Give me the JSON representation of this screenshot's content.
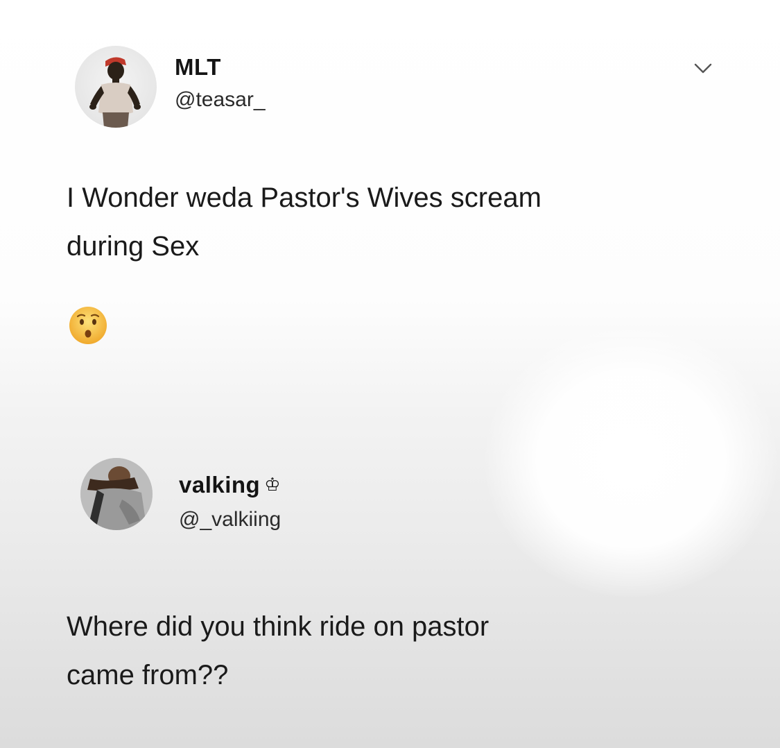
{
  "tweet_1": {
    "display_name": "MLT",
    "handle": "@teasar_",
    "text_line_1": "I Wonder weda Pastor's Wives scream",
    "text_line_2": "during Sex",
    "emoji": "hushed-face-emoji",
    "avatar": "profile-photo-avatar",
    "menu_icon": "chevron-down-icon"
  },
  "tweet_2": {
    "display_name": "valking",
    "name_suffix_glyph": "♔",
    "handle": "@_valkiing",
    "text_line_1": "Where did you think ride on pastor",
    "text_line_2": "came from??",
    "avatar": "profile-photo-avatar"
  },
  "colors": {
    "text": "#1a1a1a",
    "background_top": "#ffffff",
    "background_bottom": "#dcdcdc",
    "emoji_yellow": "#f7c244"
  }
}
